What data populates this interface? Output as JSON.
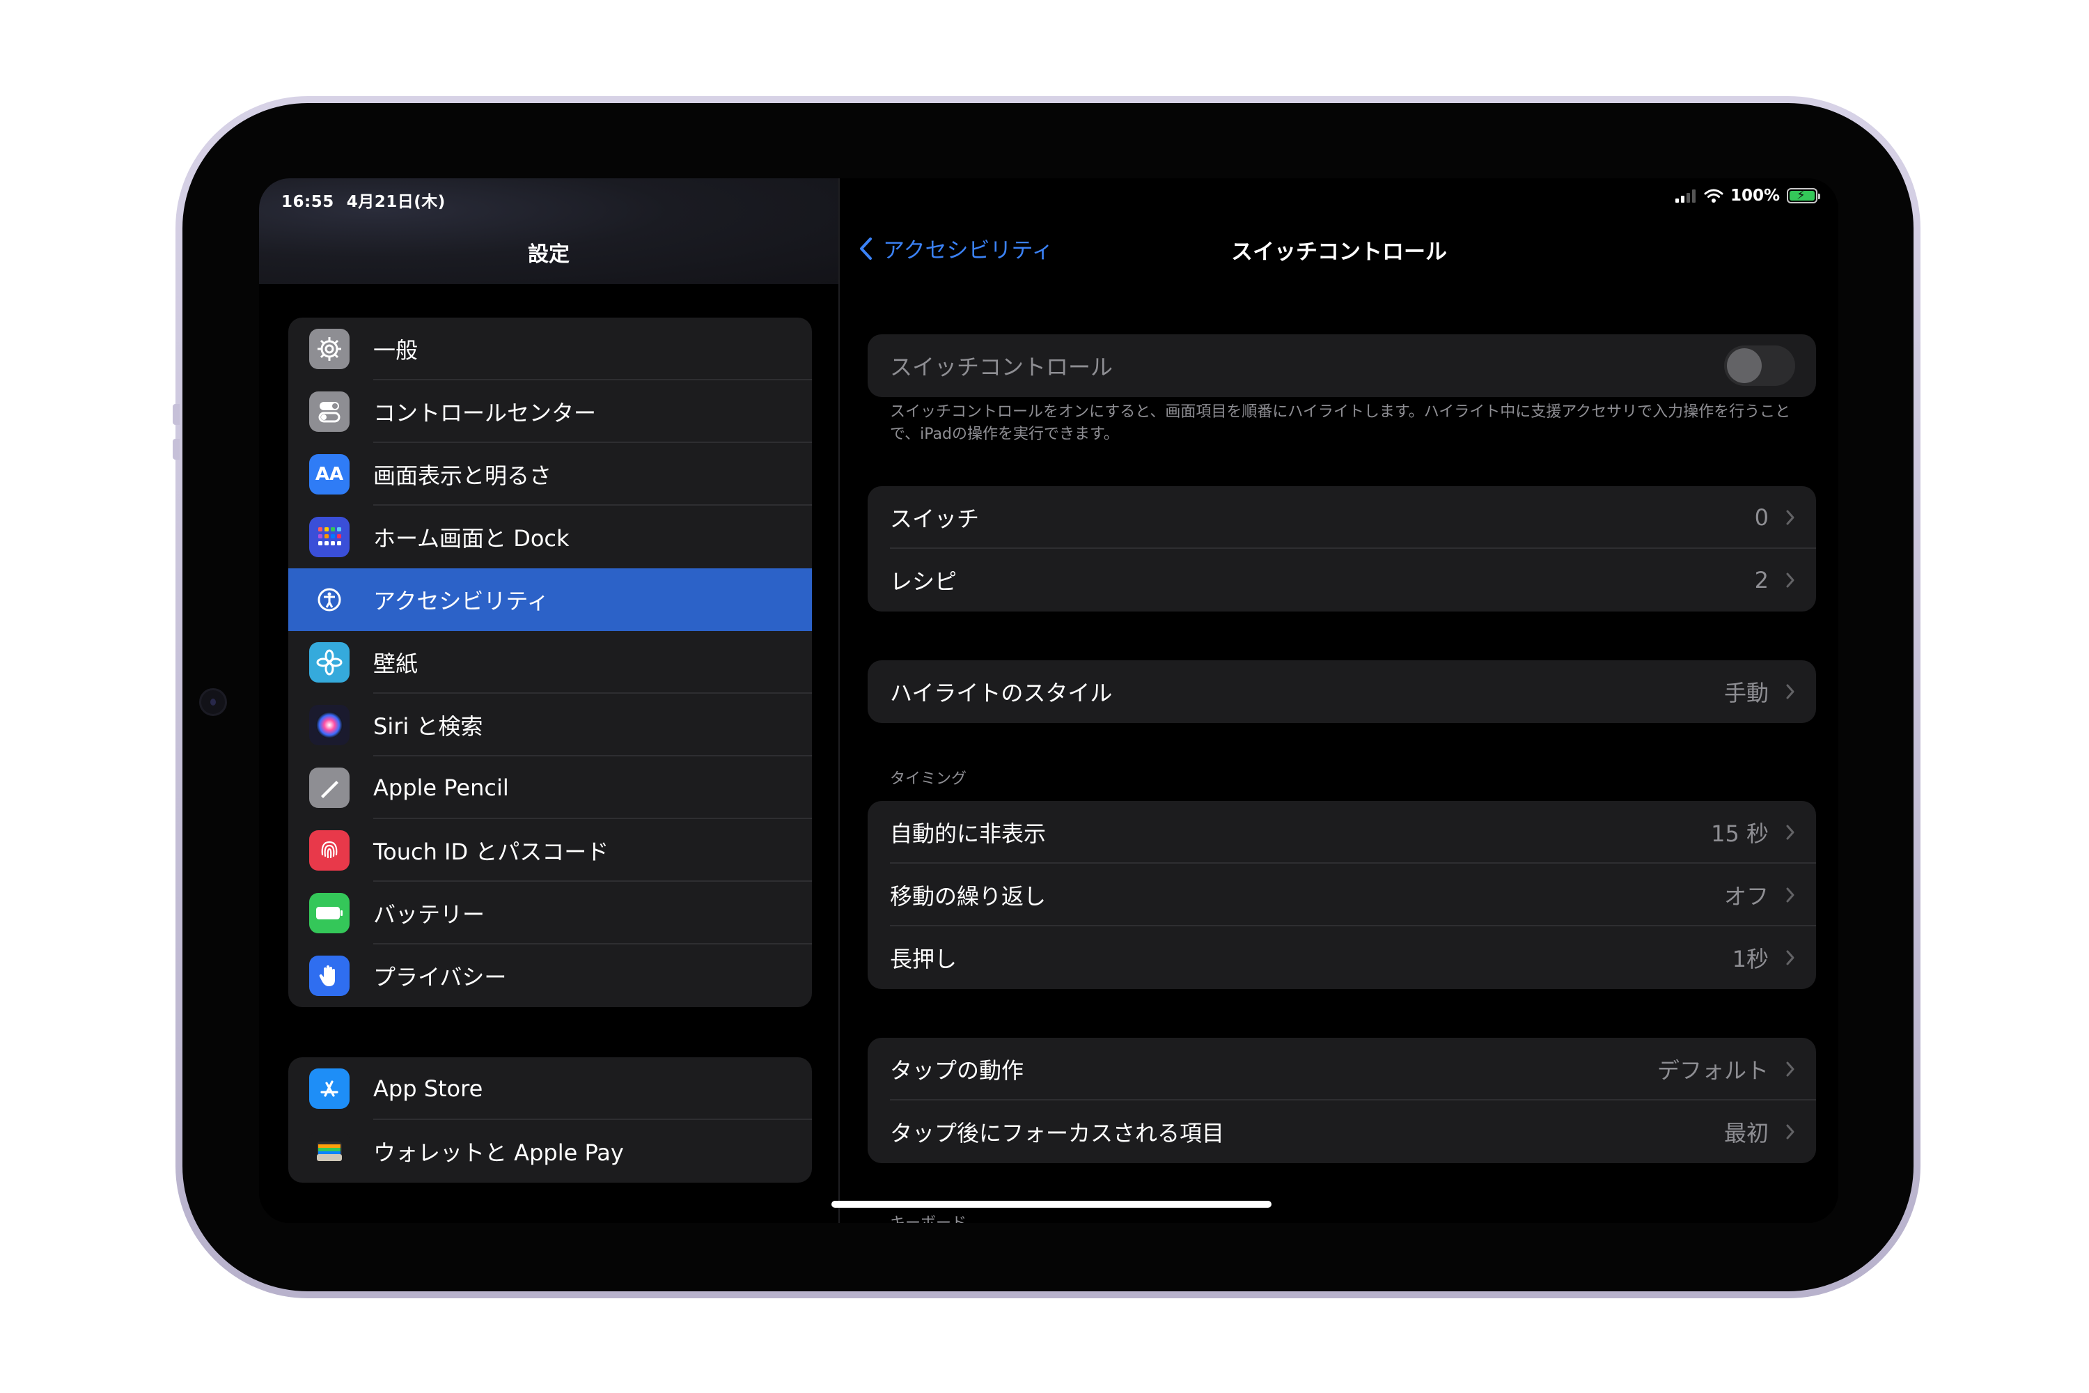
{
  "status_bar": {
    "time": "16:55",
    "date": "4月21日(木)",
    "battery_text": "100%"
  },
  "sidebar": {
    "title": "設定",
    "group1": [
      {
        "label": "一般",
        "icon": "gear-icon",
        "color": "#8e8e93"
      },
      {
        "label": "コントロールセンター",
        "icon": "toggles-icon",
        "color": "#8e8e93"
      },
      {
        "label": "画面表示と明るさ",
        "icon": "text-size-icon",
        "color": "#2f7cf6",
        "glyph": "AA"
      },
      {
        "label": "ホーム画面と Dock",
        "icon": "home-grid-icon",
        "color": "#3a4fd8"
      },
      {
        "label": "アクセシビリティ",
        "icon": "accessibility-icon",
        "color": "#2c62c8",
        "selected": true
      },
      {
        "label": "壁紙",
        "icon": "flower-icon",
        "color": "#35aadc"
      },
      {
        "label": "Siri と検索",
        "icon": "siri-icon",
        "color": "#1a1a2e"
      },
      {
        "label": "Apple Pencil",
        "icon": "pencil-icon",
        "color": "#8e8e93"
      },
      {
        "label": "Touch ID とパスコード",
        "icon": "fingerprint-icon",
        "color": "#e8394a"
      },
      {
        "label": "バッテリー",
        "icon": "battery-icon",
        "color": "#34c759"
      },
      {
        "label": "プライバシー",
        "icon": "hand-icon",
        "color": "#2f6ef0"
      }
    ],
    "group2": [
      {
        "label": "App Store",
        "icon": "app-store-icon",
        "color": "#1e8ef7"
      },
      {
        "label": "ウォレットと Apple Pay",
        "icon": "wallet-icon",
        "color": "#1c1c1e"
      }
    ]
  },
  "detail": {
    "back_label": "アクセシビリティ",
    "title": "スイッチコントロール",
    "toggle_label": "スイッチコントロール",
    "toggle_on": false,
    "footnote": "スイッチコントロールをオンにすると、画面項目を順番にハイライトします。ハイライト中に支援アクセサリで入力操作を行うことで、iPadの操作を実行できます。",
    "group_switches": [
      {
        "label": "スイッチ",
        "value": "0"
      },
      {
        "label": "レシピ",
        "value": "2"
      }
    ],
    "group_highlight": [
      {
        "label": "ハイライトのスタイル",
        "value": "手動"
      }
    ],
    "timing_header": "タイミング",
    "group_timing": [
      {
        "label": "自動的に非表示",
        "value": "15 秒"
      },
      {
        "label": "移動の繰り返し",
        "value": "オフ"
      },
      {
        "label": "長押し",
        "value": "1秒"
      }
    ],
    "group_tap": [
      {
        "label": "タップの動作",
        "value": "デフォルト"
      },
      {
        "label": "タップ後にフォーカスされる項目",
        "value": "最初"
      }
    ],
    "cut_header": "キーボード"
  }
}
